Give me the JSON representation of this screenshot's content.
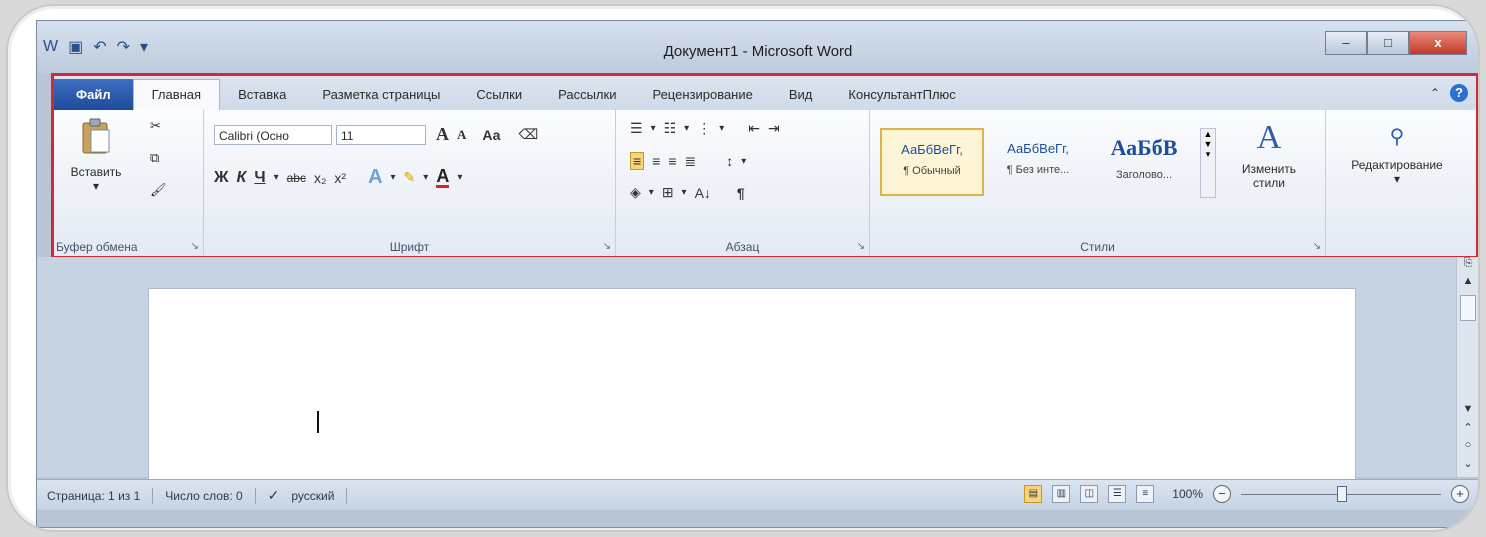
{
  "window": {
    "title": "Документ1 - Microsoft Word",
    "minimize_label": "–",
    "maximize_label": "□",
    "close_label": "x"
  },
  "quick_access": {
    "undo_icon": "undo-icon",
    "redo_icon": "redo-icon"
  },
  "tabs": [
    {
      "label": "Файл"
    },
    {
      "label": "Главная"
    },
    {
      "label": "Вставка"
    },
    {
      "label": "Разметка страницы"
    },
    {
      "label": "Ссылки"
    },
    {
      "label": "Рассылки"
    },
    {
      "label": "Рецензирование"
    },
    {
      "label": "Вид"
    },
    {
      "label": "КонсультантПлюс"
    }
  ],
  "ribbon": {
    "clipboard": {
      "paste_label": "Вставить",
      "group_label": "Буфер обмена"
    },
    "font": {
      "font_name": "Calibri (Осно",
      "font_size": "11",
      "grow": "A",
      "shrink": "A",
      "change_case": "Аа",
      "bold": "Ж",
      "italic": "К",
      "underline": "Ч",
      "strike": "abc",
      "subscript": "x₂",
      "superscript": "x²",
      "group_label": "Шрифт"
    },
    "paragraph": {
      "sort": "А↓",
      "pilcrow": "¶",
      "group_label": "Абзац"
    },
    "styles": {
      "items": [
        {
          "sample": "АаБбВеГг,",
          "name": "¶ Обычный"
        },
        {
          "sample": "АаБбВеГг,",
          "name": "¶ Без инте..."
        },
        {
          "sample": "АаБбВ",
          "name": "Заголово..."
        }
      ],
      "change_label": "Изменить стили",
      "group_label": "Стили"
    },
    "editing": {
      "label": "Редактирование"
    }
  },
  "statusbar": {
    "page": "Страница: 1 из 1",
    "words": "Число слов: 0",
    "language": "русский",
    "zoom": "100%",
    "zoom_minus": "−",
    "zoom_plus": "+",
    "zoom_level_percent": 100
  }
}
